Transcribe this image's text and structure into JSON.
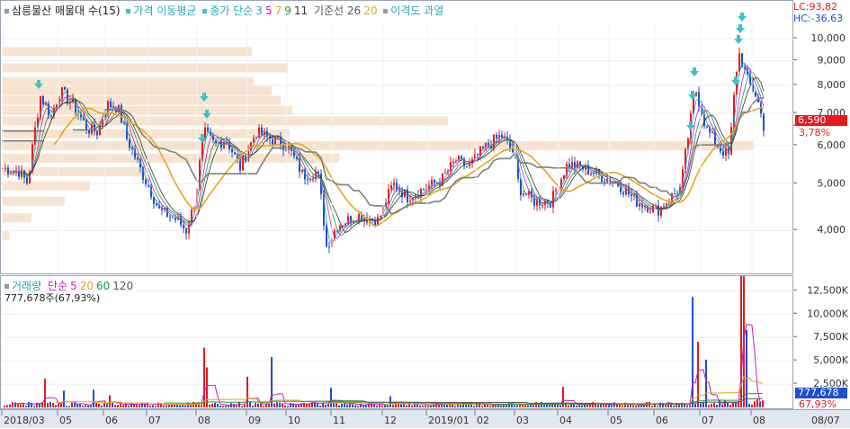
{
  "legend_price": {
    "title": "삼릉물산 매물대 수(15)",
    "ma_label": "가격 이동평균",
    "ma_type": "종가 단순",
    "ma_periods": [
      "3",
      "5",
      "7",
      "9",
      "11"
    ],
    "base_line": "기준선 26",
    "base_line_2": "20",
    "disparity": "이격도 과열"
  },
  "legend_volume": {
    "title": "거래량",
    "ma_type": "단순",
    "ma_periods": [
      "5",
      "20",
      "60",
      "120"
    ],
    "current": "777,678주(67,93%)"
  },
  "right_info": {
    "lc": "LC:93,82",
    "hc": "HC:-36,63"
  },
  "price_badge": {
    "value": "6,590",
    "change": "3,78%"
  },
  "volume_badge": {
    "value": "777,678",
    "pct": "67,93%"
  },
  "price_axis_ticks": [
    "10,000",
    "9,000",
    "8,000",
    "7,000",
    "6,000",
    "5,000",
    "4,000"
  ],
  "volume_axis_ticks": [
    "12,500K",
    "10,000K",
    "7,500K",
    "5,000K",
    "2,500K"
  ],
  "date_axis_ticks": [
    "2018/03",
    "05",
    "06",
    "07",
    "08",
    "09",
    "10",
    "11",
    "12",
    "2019/01",
    "02",
    "03",
    "04",
    "05",
    "06",
    "07",
    "08",
    "08/07"
  ],
  "colors": {
    "up": "#e8191d",
    "down": "#1f4fcf",
    "volume_profile": "#f7e3cf",
    "baseline": "#7f7f7f",
    "ma_long": "#e2a71a",
    "arrow": "#3cc3c8",
    "price_badge": "#e8191d",
    "volume_badge": "#1f4fcf"
  },
  "chart_data": {
    "type": "candlestick",
    "y_scale": "log",
    "ylim": [
      3300,
      10900
    ],
    "price_series_approx": [
      {
        "date": "2018/03",
        "close": 5400
      },
      {
        "date": "2018/04",
        "close": 7600
      },
      {
        "date": "2018/05",
        "close": 6900
      },
      {
        "date": "2018/06",
        "close": 6600
      },
      {
        "date": "2018/07",
        "close": 4300
      },
      {
        "date": "2018/08",
        "close": 6400
      },
      {
        "date": "2018/09",
        "close": 6200
      },
      {
        "date": "2018/10",
        "close": 5200
      },
      {
        "date": "2018/11",
        "close": 4100
      },
      {
        "date": "2018/12",
        "close": 4800
      },
      {
        "date": "2019/01",
        "close": 5300
      },
      {
        "date": "2019/02",
        "close": 6100
      },
      {
        "date": "2019/03",
        "close": 4600
      },
      {
        "date": "2019/04",
        "close": 5300
      },
      {
        "date": "2019/05",
        "close": 5100
      },
      {
        "date": "2019/06",
        "close": 4500
      },
      {
        "date": "2019/07",
        "close": 8200
      },
      {
        "date": "2019/08",
        "close": 6590
      }
    ],
    "volume_ylim": [
      0,
      13500000
    ]
  }
}
